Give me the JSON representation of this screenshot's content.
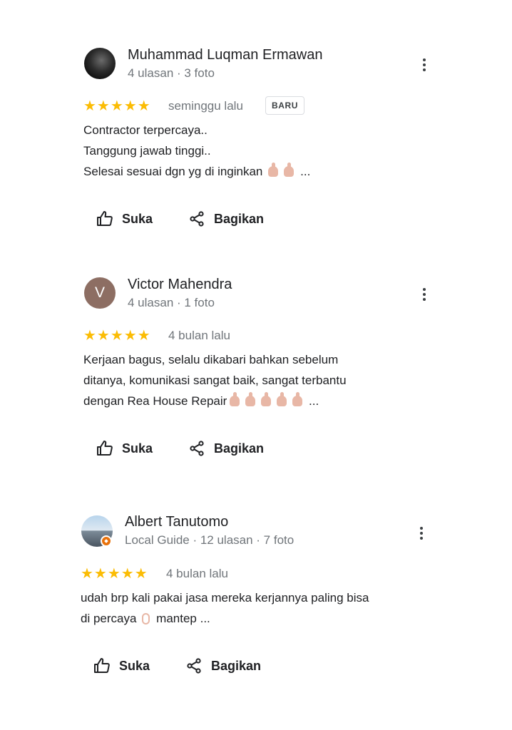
{
  "reviews": [
    {
      "name": "Muhammad Luqman Ermawan",
      "meta": "4 ulasan · 3 foto",
      "avatar_letter": "",
      "stars": "★★★★★",
      "rating": 5,
      "time": "seminggu lalu",
      "badge": "BARU",
      "lines": [
        "Contractor terpercaya..",
        "Tanggung jawab tinggi..",
        "Selesai sesuai dgn yg di inginkan"
      ],
      "more": "...",
      "like_label": "Suka",
      "share_label": "Bagikan"
    },
    {
      "name": "Victor Mahendra",
      "meta": "4 ulasan · 1 foto",
      "avatar_letter": "V",
      "stars": "★★★★★",
      "rating": 5,
      "time": "4 bulan lalu",
      "badge": "",
      "lines": [
        "Kerjaan bagus, selalu dikabari bahkan sebelum",
        "ditanya, komunikasi sangat baik, sangat terbantu",
        "dengan Rea House Repair"
      ],
      "more": "...",
      "like_label": "Suka",
      "share_label": "Bagikan"
    },
    {
      "name": "Albert Tanutomo",
      "meta": "Local Guide · 12 ulasan · 7 foto",
      "avatar_letter": "",
      "stars": "★★★★★",
      "rating": 5,
      "time": "4 bulan lalu",
      "badge": "",
      "lines": [
        "udah brp kali pakai jasa mereka kerjannya paling bisa",
        "di percaya",
        "mantep ..."
      ],
      "more": "",
      "like_label": "Suka",
      "share_label": "Bagikan"
    }
  ],
  "colors": {
    "star": "#fbbc04",
    "meta_text": "#70757a",
    "avatar_v": "#8d6e63",
    "local_guide_badge": "#e8710a"
  },
  "icons": {
    "like": "thumb-up-icon",
    "share": "share-icon",
    "menu": "more-vert-icon"
  }
}
